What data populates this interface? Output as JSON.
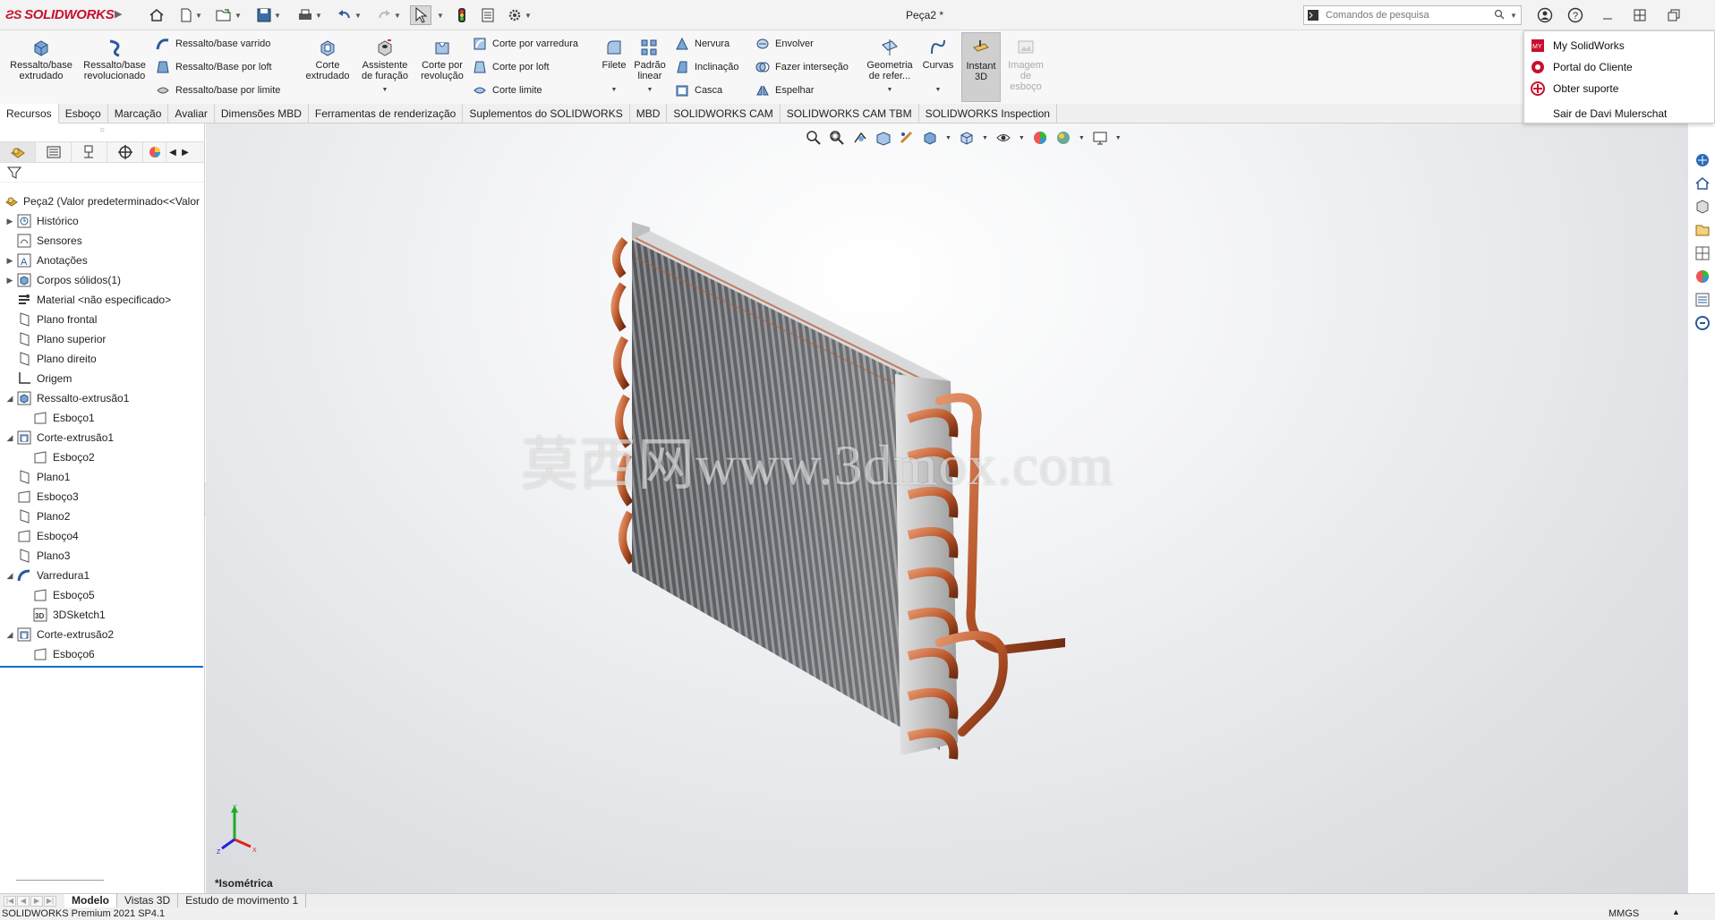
{
  "app": {
    "brand": "SOLIDWORKS",
    "document_title": "Peça2 *",
    "search_placeholder": "Comandos de pesquisa"
  },
  "ribbon": {
    "large_buttons": [
      {
        "label": "Ressalto/base\nextrudado",
        "icon": "extruded-boss-icon"
      },
      {
        "label": "Ressalto/base\nrevolucionado",
        "icon": "revolved-boss-icon"
      },
      {
        "label": "Corte\nextrudado",
        "icon": "extruded-cut-icon"
      },
      {
        "label": "Assistente\nde furação",
        "icon": "hole-wizard-icon"
      },
      {
        "label": "Corte por\nrevolução",
        "icon": "revolved-cut-icon"
      },
      {
        "label": "Filete",
        "icon": "fillet-icon"
      },
      {
        "label": "Padrão\nlinear",
        "icon": "linear-pattern-icon"
      },
      {
        "label": "Geometria\nde refer...",
        "icon": "reference-geometry-icon"
      },
      {
        "label": "Curvas",
        "icon": "curves-icon"
      },
      {
        "label": "Instant\n3D",
        "icon": "instant3d-icon"
      },
      {
        "label": "Imagem\nde\nesboço",
        "icon": "sketch-picture-icon"
      }
    ],
    "small_buttons": [
      {
        "label": "Ressalto/base varrido",
        "icon": "swept-boss-icon"
      },
      {
        "label": "Ressalto/Base por loft",
        "icon": "lofted-boss-icon"
      },
      {
        "label": "Ressalto/base por limite",
        "icon": "boundary-boss-icon"
      },
      {
        "label": "Corte por varredura",
        "icon": "swept-cut-icon"
      },
      {
        "label": "Corte por loft",
        "icon": "lofted-cut-icon"
      },
      {
        "label": "Corte limite",
        "icon": "boundary-cut-icon"
      },
      {
        "label": "Nervura",
        "icon": "rib-icon"
      },
      {
        "label": "Inclinação",
        "icon": "draft-icon"
      },
      {
        "label": "Casca",
        "icon": "shell-icon"
      },
      {
        "label": "Envolver",
        "icon": "wrap-icon"
      },
      {
        "label": "Fazer interseção",
        "icon": "intersect-icon"
      },
      {
        "label": "Espelhar",
        "icon": "mirror-icon"
      }
    ]
  },
  "tabs": [
    "Recursos",
    "Esboço",
    "Marcação",
    "Avaliar",
    "Dimensões MBD",
    "Ferramentas de renderização",
    "Suplementos do SOLIDWORKS",
    "MBD",
    "SOLIDWORKS CAM",
    "SOLIDWORKS CAM TBM",
    "SOLIDWORKS Inspection"
  ],
  "tree": {
    "root": "Peça2  (Valor predeterminado<<Valor",
    "nodes": [
      {
        "label": "Histórico",
        "icon": "history-icon",
        "expander": "▶"
      },
      {
        "label": "Sensores",
        "icon": "sensors-icon",
        "expander": ""
      },
      {
        "label": "Anotações",
        "icon": "annotations-icon",
        "expander": "▶"
      },
      {
        "label": "Corpos sólidos(1)",
        "icon": "solid-bodies-icon",
        "expander": "▶"
      },
      {
        "label": "Material <não especificado>",
        "icon": "material-icon",
        "expander": ""
      },
      {
        "label": "Plano frontal",
        "icon": "plane-icon",
        "expander": ""
      },
      {
        "label": "Plano superior",
        "icon": "plane-icon",
        "expander": ""
      },
      {
        "label": "Plano direito",
        "icon": "plane-icon",
        "expander": ""
      },
      {
        "label": "Origem",
        "icon": "origin-icon",
        "expander": ""
      },
      {
        "label": "Ressalto-extrusão1",
        "icon": "extruded-boss-icon",
        "expander": "◢"
      },
      {
        "label": "Esboço1",
        "icon": "sketch-icon",
        "expander": "",
        "indent": true
      },
      {
        "label": "Corte-extrusão1",
        "icon": "extruded-cut-icon",
        "expander": "◢"
      },
      {
        "label": "Esboço2",
        "icon": "sketch-icon",
        "expander": "",
        "indent": true
      },
      {
        "label": "Plano1",
        "icon": "plane-icon",
        "expander": ""
      },
      {
        "label": "Esboço3",
        "icon": "sketch-icon",
        "expander": ""
      },
      {
        "label": "Plano2",
        "icon": "plane-icon",
        "expander": ""
      },
      {
        "label": "Esboço4",
        "icon": "sketch-icon",
        "expander": ""
      },
      {
        "label": "Plano3",
        "icon": "plane-icon",
        "expander": ""
      },
      {
        "label": "Varredura1",
        "icon": "sweep-icon",
        "expander": "◢"
      },
      {
        "label": "Esboço5",
        "icon": "sketch-icon",
        "expander": "",
        "indent": true
      },
      {
        "label": "3DSketch1",
        "icon": "3d-sketch-icon",
        "expander": "",
        "indent": true
      },
      {
        "label": "Corte-extrusão2",
        "icon": "extruded-cut-icon",
        "expander": "◢"
      },
      {
        "label": "Esboço6",
        "icon": "sketch-icon",
        "expander": "",
        "indent": true
      }
    ]
  },
  "graphics": {
    "watermark": "莫西网www.3dmox.com",
    "view_label": "*Isométrica"
  },
  "help_menu": [
    {
      "label": "My SolidWorks",
      "icon": "mysolidworks-icon"
    },
    {
      "label": "Portal do Cliente",
      "icon": "customer-portal-icon"
    },
    {
      "label": "Obter suporte",
      "icon": "support-icon"
    },
    {
      "label": "Sair de Davi Mulerschat",
      "icon": ""
    }
  ],
  "bottom_tabs": [
    "Modelo",
    "Vistas 3D",
    "Estudo de movimento 1"
  ],
  "status": {
    "product": "SOLIDWORKS Premium 2021 SP4.1",
    "units": "MMGS"
  },
  "colors": {
    "brand_red": "#c8102e",
    "copper": "#b8562a",
    "selection_blue": "#0b6ec7"
  }
}
